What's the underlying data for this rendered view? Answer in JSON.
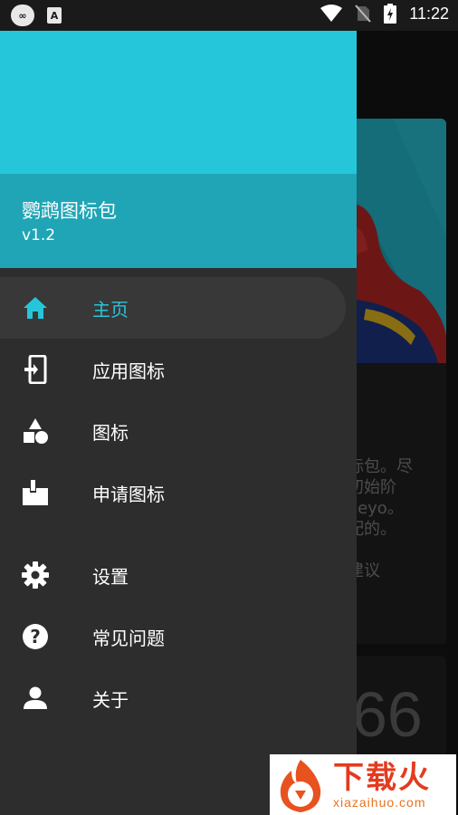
{
  "status_bar": {
    "left_icons": [
      "infinity-icon",
      "a-icon"
    ],
    "right_icons": [
      "wifi-icon",
      "no-sim-icon",
      "battery-charging-icon"
    ],
    "time": "11:22"
  },
  "drawer": {
    "header": {
      "title": "鹦鹉图标包",
      "version": "v1.2",
      "color": "#26c6da"
    },
    "items": [
      {
        "label": "主页",
        "icon": "home-icon",
        "active": true
      },
      {
        "label": "应用图标",
        "icon": "apply-phone-icon",
        "active": false
      },
      {
        "label": "图标",
        "icon": "shapes-icon",
        "active": false
      },
      {
        "label": "申请图标",
        "icon": "mailbox-icon",
        "active": false
      },
      {
        "label": "设置",
        "icon": "gear-icon",
        "active": false
      },
      {
        "label": "常见问题",
        "icon": "help-icon",
        "active": false
      },
      {
        "label": "关于",
        "icon": "person-icon",
        "active": false
      }
    ],
    "accent_color": "#26c6da"
  },
  "background_app": {
    "partial_text": "标包。尽\n初始阶\neeyo。\n配的。\n\n建议\n：",
    "partial_number": "66"
  },
  "watermark": {
    "text_cn": "下载火",
    "text_en": "xiazaihuo.com"
  }
}
